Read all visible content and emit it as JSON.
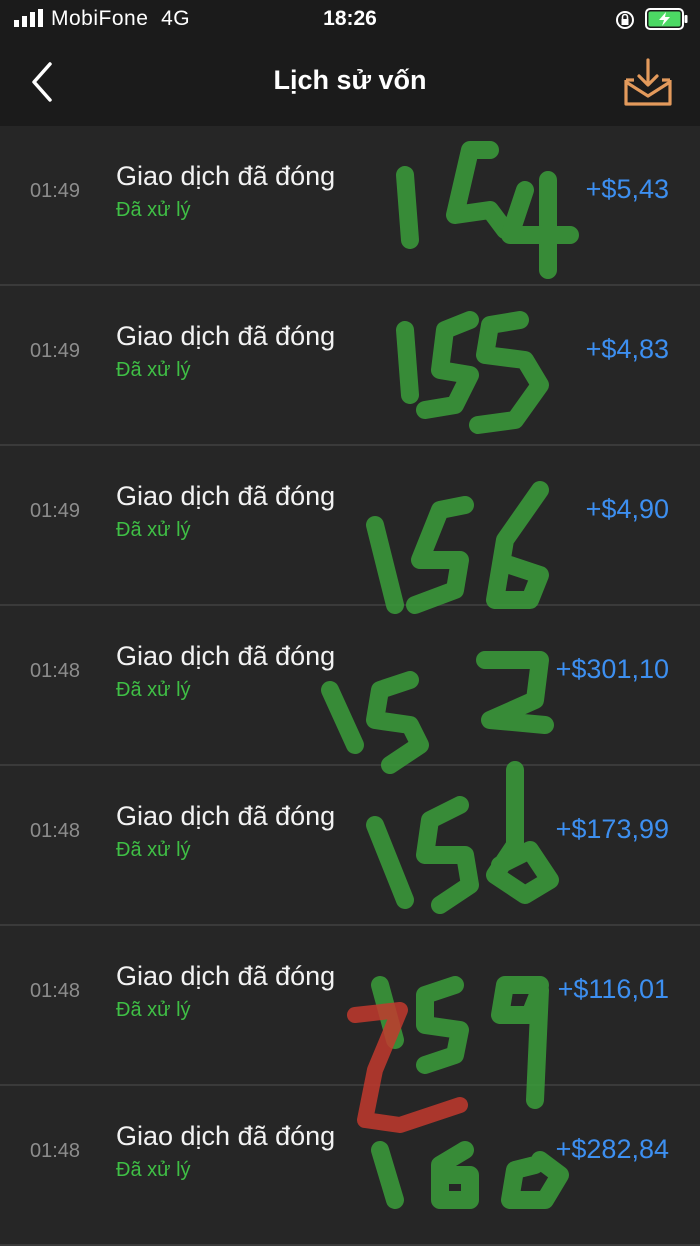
{
  "status_bar": {
    "carrier": "MobiFone",
    "network": "4G",
    "time": "18:26"
  },
  "header": {
    "title": "Lịch sử vốn"
  },
  "transactions": [
    {
      "time": "01:49",
      "name": "Giao dịch đã đóng",
      "status": "Đã xử lý",
      "amount": "+$5,43"
    },
    {
      "time": "01:49",
      "name": "Giao dịch đã đóng",
      "status": "Đã xử lý",
      "amount": "+$4,83"
    },
    {
      "time": "01:49",
      "name": "Giao dịch đã đóng",
      "status": "Đã xử lý",
      "amount": "+$4,90"
    },
    {
      "time": "01:48",
      "name": "Giao dịch đã đóng",
      "status": "Đã xử lý",
      "amount": "+$301,10"
    },
    {
      "time": "01:48",
      "name": "Giao dịch đã đóng",
      "status": "Đã xử lý",
      "amount": "+$173,99"
    },
    {
      "time": "01:48",
      "name": "Giao dịch đã đóng",
      "status": "Đã xử lý",
      "amount": "+$116,01"
    },
    {
      "time": "01:48",
      "name": "Giao dịch đã đóng",
      "status": "Đã xử lý",
      "amount": "+$282,84"
    }
  ],
  "colors": {
    "background": "#262626",
    "bar": "#1b1b1b",
    "status_green": "#3fbf45",
    "amount_blue": "#3d8ff0",
    "icon_orange": "#e39a5c",
    "annotation_green": "#3a9a3a",
    "annotation_red": "#c23a2e"
  },
  "annotations": {
    "handwritten_numbers": [
      "154",
      "155",
      "156",
      "152",
      "158",
      "159",
      "160"
    ],
    "note": "Handwritten green/red marker drawn over the list"
  }
}
